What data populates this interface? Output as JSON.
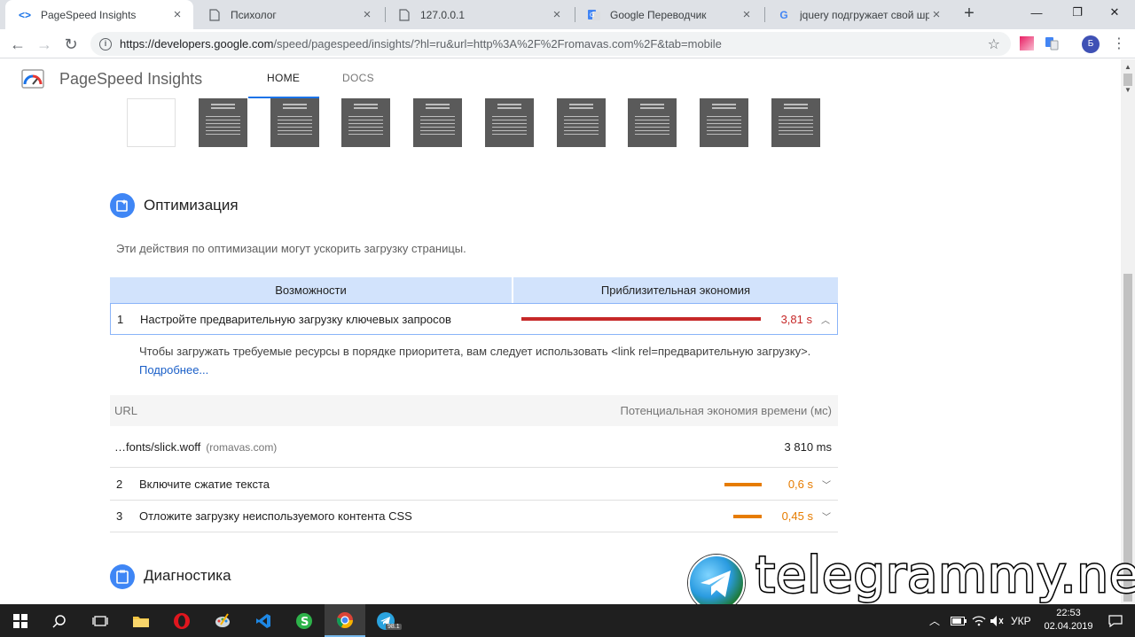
{
  "browser": {
    "tabs": [
      {
        "title": "PageSpeed Insights",
        "active": true
      },
      {
        "title": "Психолог",
        "active": false
      },
      {
        "title": "127.0.0.1",
        "active": false
      },
      {
        "title": "Google Переводчик",
        "active": false
      },
      {
        "title": "jquery подгружает свой шриф",
        "active": false
      }
    ],
    "url_host": "https://developers.google.com",
    "url_path": "/speed/pagespeed/insights/?hl=ru&url=http%3A%2F%2Fromavas.com%2F&tab=mobile",
    "profile_initial": "Б"
  },
  "header": {
    "brand": "PageSpeed Insights",
    "nav_home": "HOME",
    "nav_docs": "DOCS"
  },
  "optimization": {
    "title": "Оптимизация",
    "description": "Эти действия по оптимизации могут ускорить загрузку страницы.",
    "col_opportunity": "Возможности",
    "col_savings": "Приблизительная экономия",
    "items": [
      {
        "num": "1",
        "title": "Настройте предварительную загрузку ключевых запросов",
        "value": "3,81 s",
        "bar_fraction": 1.0,
        "color": "#c62828"
      },
      {
        "num": "2",
        "title": "Включите сжатие текста",
        "value": "0,6 s",
        "bar_fraction": 0.157,
        "color": "#e67c00"
      },
      {
        "num": "3",
        "title": "Отложите загрузку неиспользуемого контента CSS",
        "value": "0,45 s",
        "bar_fraction": 0.118,
        "color": "#e67c00"
      }
    ],
    "detail_text": "Чтобы загружать требуемые ресурсы в порядке приоритета, вам следует использовать <link rel=предварительную загрузку>.",
    "detail_link": "Подробнее...",
    "url_col": "URL",
    "savings_col": "Потенциальная экономия времени (мс)",
    "url_rows": [
      {
        "file": "…fonts/slick.woff",
        "host": "(romavas.com)",
        "value": "3 810 ms"
      }
    ]
  },
  "diagnostics": {
    "title": "Диагностика"
  },
  "watermark": {
    "text": "telegrammy.net"
  },
  "taskbar": {
    "lang": "УКР",
    "time": "22:53",
    "date": "02.04.2019",
    "telegram_badge": "98.1"
  },
  "colors": {
    "accent": "#1a73e8",
    "header_fill": "#d2e3fc",
    "bar_red": "#c62828",
    "bar_orange": "#e67c00"
  }
}
